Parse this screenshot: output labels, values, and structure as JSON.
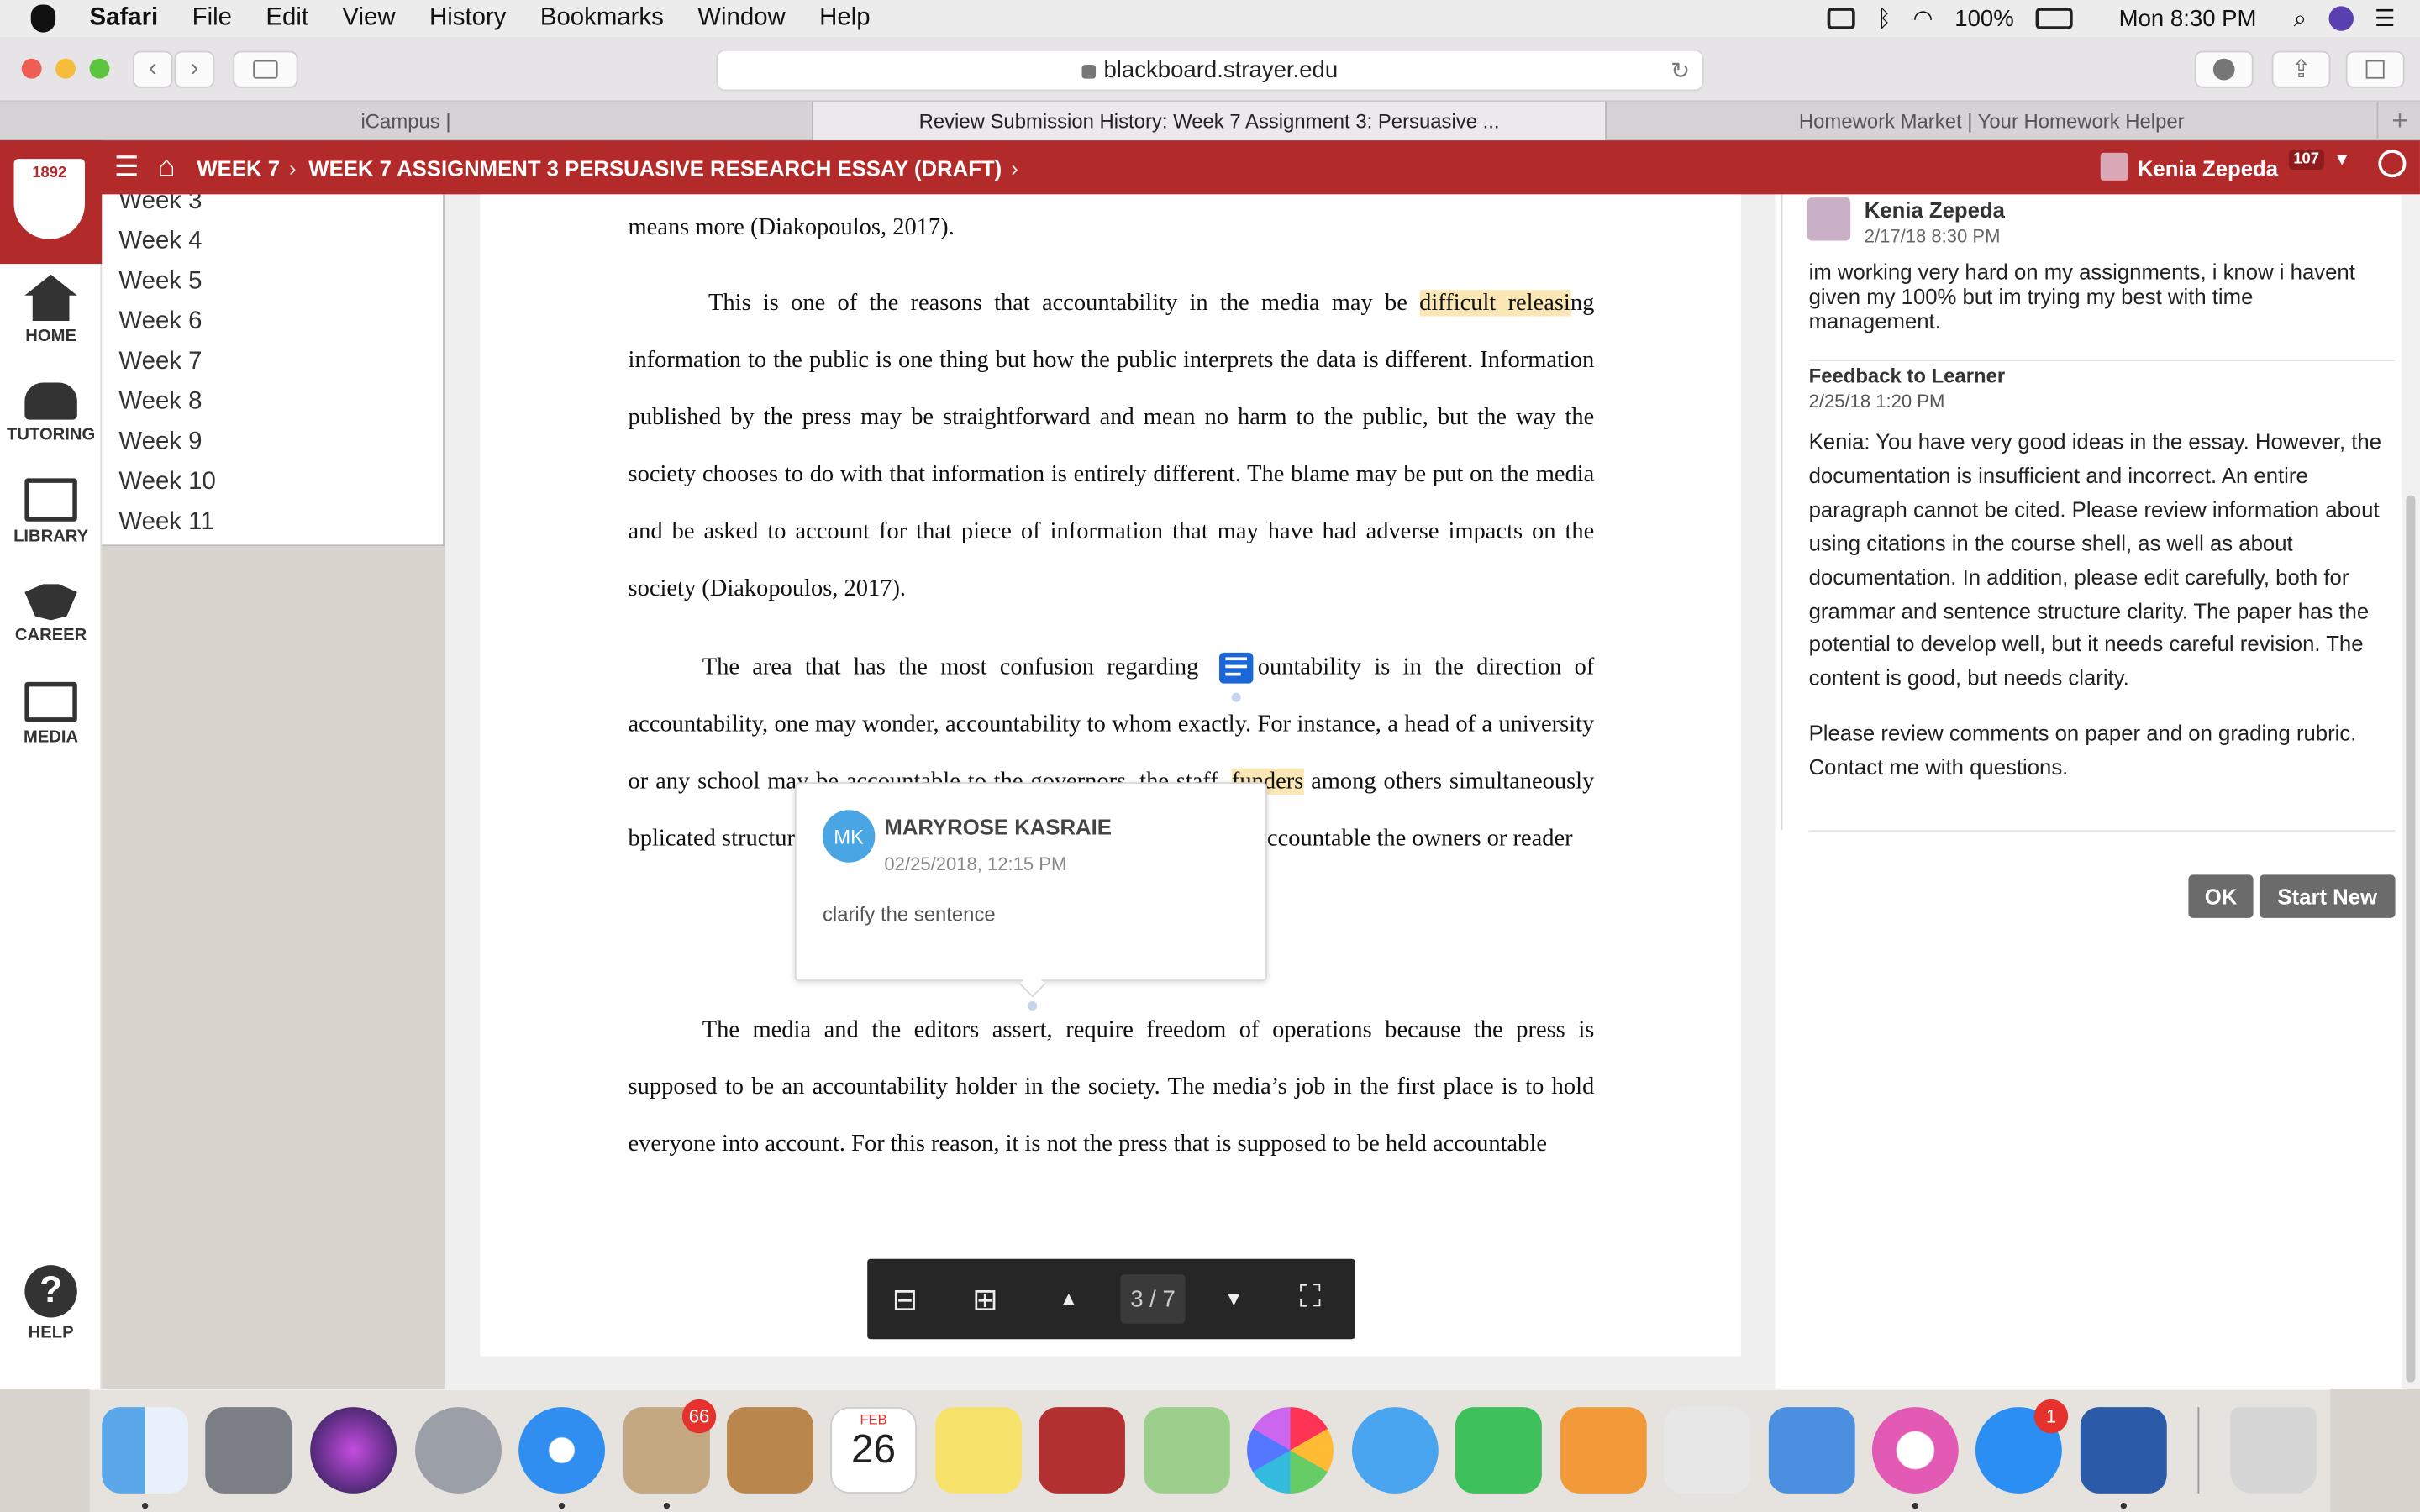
{
  "menubar": {
    "app": "Safari",
    "items": [
      "File",
      "Edit",
      "View",
      "History",
      "Bookmarks",
      "Window",
      "Help"
    ],
    "battery": "100%",
    "clock": "Mon 8:30 PM"
  },
  "browser": {
    "url": "blackboard.strayer.edu",
    "tabs": [
      "iCampus |",
      "Review Submission History: Week 7 Assignment 3: Persuasive ...",
      "Homework Market | Your Homework Helper"
    ],
    "new_tab": "+"
  },
  "nav": {
    "logo_year": "1892",
    "crumbs": [
      "WEEK 7",
      "WEEK 7 ASSIGNMENT 3 PERSUASIVE RESEARCH ESSAY (DRAFT)"
    ],
    "user": "Kenia Zepeda",
    "notifications": "107"
  },
  "sidebar": {
    "items": [
      "HOME",
      "TUTORING",
      "LIBRARY",
      "CAREER",
      "MEDIA"
    ],
    "help": "HELP"
  },
  "weeks": [
    "Week 3",
    "Week 4",
    "Week 5",
    "Week 6",
    "Week 7",
    "Week 8",
    "Week 9",
    "Week 10",
    "Week 11"
  ],
  "document": {
    "p0": "means more (Diakopoulos, 2017).",
    "p1a": "This is one of the reasons that accountability in the media may be ",
    "p1hl": "difficult releasi",
    "p1b": "ng information to the public is one thing but how the public interprets the data is different. Information published by the press may be straightforward and mean no harm to the public, but the way the society chooses to do with that information is entirely different. The blame may be put on the media and be asked to account for that piece of information that may have had adverse impacts on the society (Diakopoulos, 2017).",
    "p2a": "The area that has the most confusion regarding ",
    "p2b": "ountability is in the direction of accountability, one may wonder, accountability to whom exactly. For instance, a head of a university or any ",
    "p2c": "school may be accountable to the governors, the staff, ",
    "p2hl": "funders",
    "p2d": " among others simultaneously b",
    "p2e": "plicated structure and a set of uncertainties. It i",
    "p2f": "sed to be judged accountable the owners or reader",
    "p3": "The media and the editors assert, require freedom of operations because the press is supposed to be an accountability holder in the society. The media’s job in the first place is to hold everyone into account. For this reason, it is not the press that is supposed to be held accountable"
  },
  "annotation": {
    "initials": "MK",
    "author": "MARYROSE KASRAIE",
    "date": "02/25/2018, 12:15 PM",
    "text": "clarify the sentence"
  },
  "pager": {
    "page": "3 / 7"
  },
  "comments": {
    "student_name": "Kenia Zepeda",
    "student_date": "2/17/18 8:30 PM",
    "student_text": "im working very hard on my assignments, i know i havent given my 100% but im trying my best with time management.",
    "feedback_title": "Feedback to Learner",
    "feedback_date": "2/25/18 1:20 PM",
    "feedback_text": "Kenia: You have very good ideas in the essay. However, the documentation is insufficient and incorrect. An entire paragraph cannot be cited. Please review information about using citations in the course shell, as well as about documentation. In addition, please edit carefully, both for grammar and sentence structure clarity. The paper has the potential to develop well, but it needs careful revision. The content is good, but needs clarity.",
    "feedback_text2": "Please review comments on paper and on grading rubric. Contact me with questions.",
    "ok": "OK",
    "start_new": "Start New"
  },
  "dock": {
    "mail_badge": "66",
    "calendar_month": "FEB",
    "calendar_day": "26",
    "appstore_badge": "1"
  },
  "colors": {
    "brand_red": "#b32a2a",
    "highlight": "#fbe7b6",
    "annotation_blue": "#1b67d9"
  }
}
